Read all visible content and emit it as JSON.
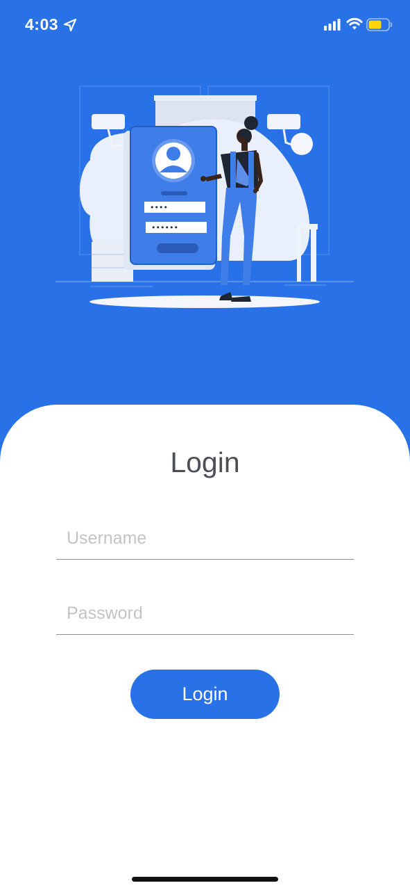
{
  "status_bar": {
    "time": "4:03",
    "location_icon": "location-arrow-icon",
    "signal_icon": "cellular-signal-icon",
    "wifi_icon": "wifi-icon",
    "battery_icon": "battery-icon",
    "battery_color": "#ffd60a"
  },
  "illustration": {
    "password_mask_1": "••••",
    "password_mask_2": "••••••"
  },
  "login": {
    "title": "Login",
    "username_placeholder": "Username",
    "password_placeholder": "Password",
    "button_label": "Login"
  },
  "colors": {
    "brand_blue": "#2871e6",
    "panel_bg": "#ffffff",
    "title_text": "#4c4f55",
    "placeholder_text": "#c3c3c6"
  }
}
